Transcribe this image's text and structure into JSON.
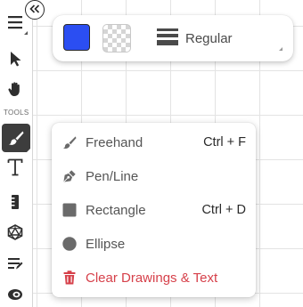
{
  "toolbar": {
    "section_label": "TOOLS",
    "tools": [
      {
        "name": "menu",
        "icon": "hamburger-menu-icon"
      },
      {
        "name": "select",
        "icon": "pointer-arrow-icon"
      },
      {
        "name": "pan",
        "icon": "hand-icon"
      },
      {
        "name": "draw",
        "icon": "brush-icon",
        "active": true
      },
      {
        "name": "text",
        "icon": "text-cursor-icon"
      },
      {
        "name": "measure",
        "icon": "ruler-icon"
      },
      {
        "name": "dice",
        "icon": "d20-dice-icon"
      },
      {
        "name": "notes",
        "icon": "note-list-icon"
      },
      {
        "name": "tokens",
        "icon": "token-icon"
      }
    ]
  },
  "style_panel": {
    "stroke_color": "#2b4ef2",
    "fill": "transparent",
    "stroke_style_label": "Regular"
  },
  "draw_menu": {
    "items": [
      {
        "label": "Freehand",
        "shortcut": "Ctrl + F",
        "icon": "brush-icon"
      },
      {
        "label": "Pen/Line",
        "shortcut": "",
        "icon": "pen-nib-icon"
      },
      {
        "label": "Rectangle",
        "shortcut": "Ctrl + D",
        "icon": "square-icon"
      },
      {
        "label": "Ellipse",
        "shortcut": "",
        "icon": "circle-icon"
      },
      {
        "label": "Clear Drawings & Text",
        "shortcut": "",
        "icon": "trash-icon",
        "danger": true
      }
    ]
  },
  "colors": {
    "accent_blue": "#2b4ef2",
    "danger_red": "#d6404a",
    "active_tool_bg": "#3d3d3d"
  }
}
